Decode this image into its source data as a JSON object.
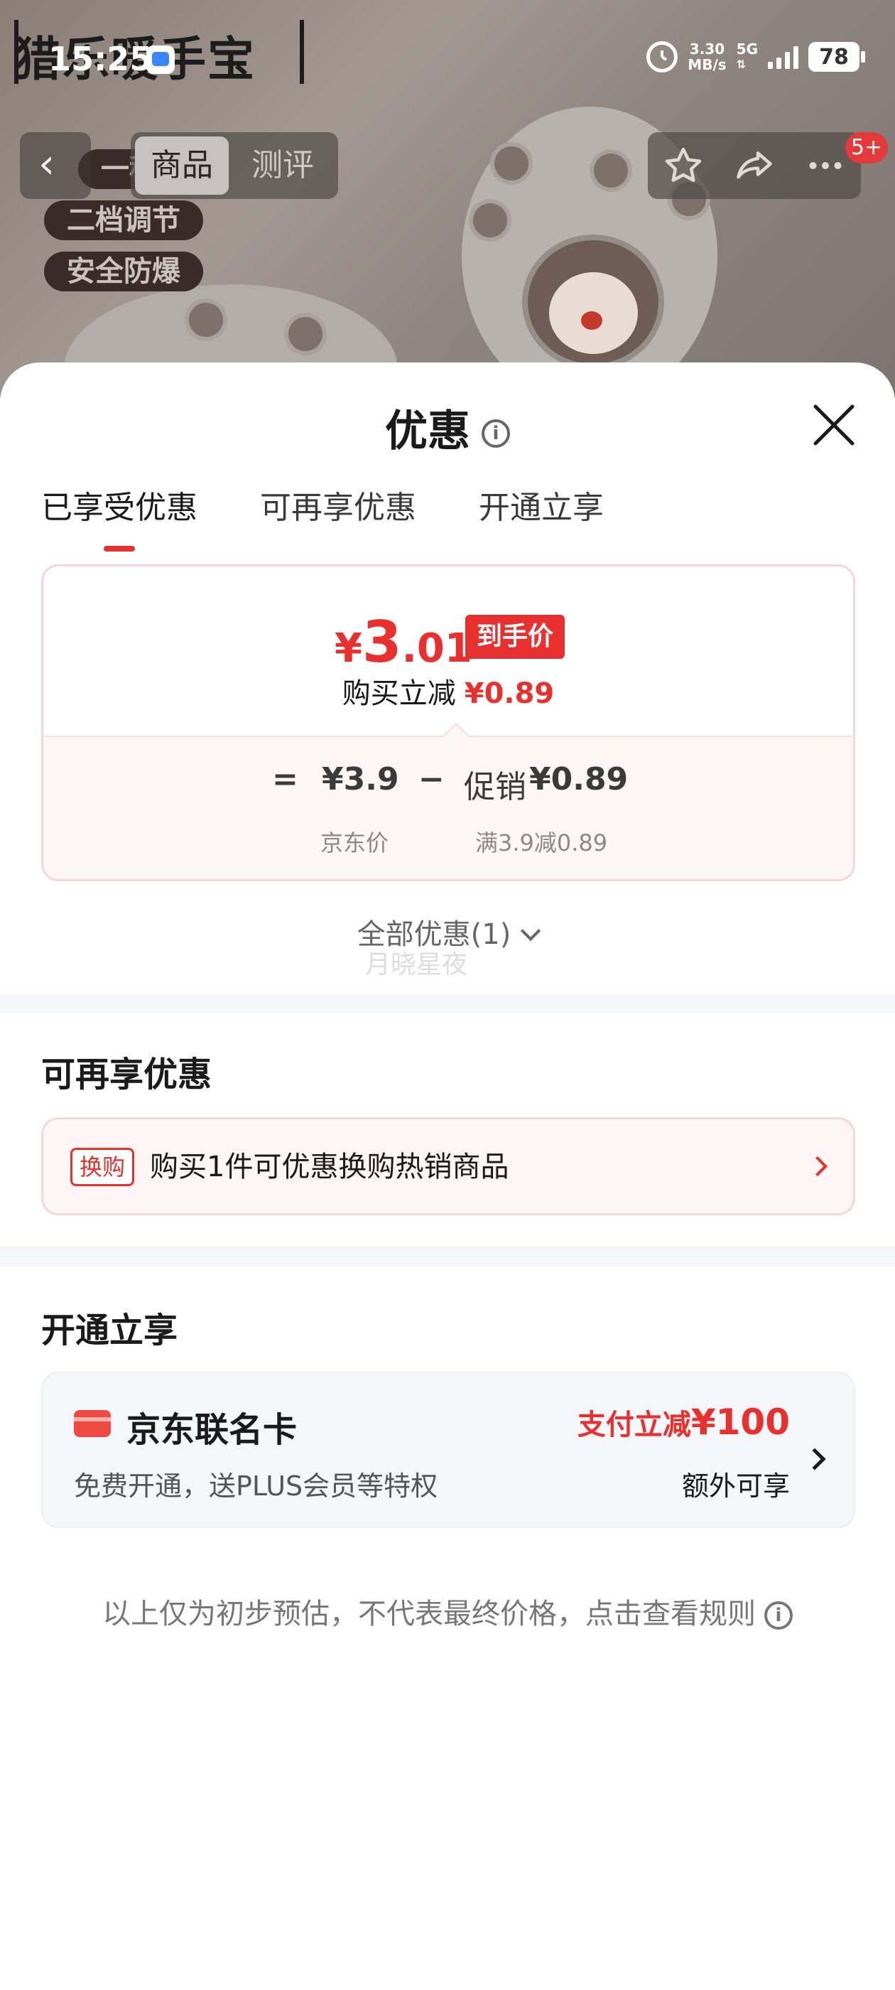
{
  "status_bar": {
    "time": "15:25",
    "net_speed_value": "3.30",
    "net_speed_unit": "MB/s",
    "network": "5G",
    "battery": "78"
  },
  "product_bg": {
    "brand_text": "猎乐暖手宝",
    "badges": [
      "一秒",
      "二档调节",
      "安全防爆"
    ]
  },
  "product_nav": {
    "back_icon": "chevron-left-icon",
    "tabs": [
      "商品",
      "测评"
    ],
    "active_tab": "商品",
    "actions": [
      "star-icon",
      "share-icon",
      "more-icon"
    ],
    "notification_badge": "5+"
  },
  "sheet": {
    "title": "优惠",
    "title_info_icon": "info-icon",
    "close_icon": "close-icon",
    "tabs": [
      "已享受优惠",
      "可再享优惠",
      "开通立享"
    ],
    "active_tab": "已享受优惠",
    "price_card": {
      "currency": "¥",
      "price_int": "3",
      "price_dec": ".01",
      "price_tag": "到手价",
      "reduce_label": "购买立减",
      "reduce_amount": "¥0.89",
      "formula": {
        "eq": "=",
        "base_price": "¥3.9",
        "minus": "−",
        "promo_label": "促销",
        "promo_amount": "¥0.89",
        "base_caption": "京东价",
        "promo_caption": "满3.9减0.89"
      }
    },
    "all_promos": "全部优惠(1)",
    "watermark": "月晓星夜",
    "section_more": {
      "title": "可再享优惠",
      "tag": "换购",
      "text": "购买1件可优惠换购热销商品"
    },
    "section_open": {
      "title": "开通立享",
      "card_name": "京东联名卡",
      "card_desc": "免费开通，送PLUS会员等特权",
      "offer_label": "支付立减",
      "offer_amount": "¥100",
      "offer_extra": "额外可享"
    },
    "disclaimer": "以上仅为初步预估，不代表最终价格，点击查看规则"
  },
  "colors": {
    "accent_red": "#e8302f",
    "card_border": "#f6d6d8",
    "muted_bg": "#f5f6fa"
  }
}
